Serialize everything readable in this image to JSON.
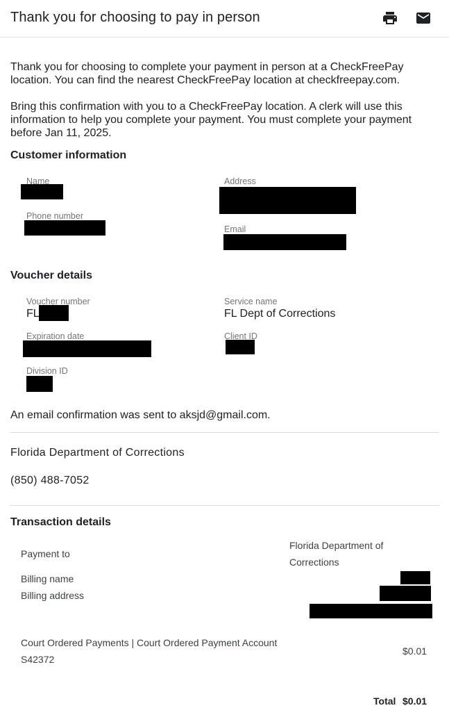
{
  "header": {
    "title": "Thank you for choosing to pay in person",
    "print_icon": "print-icon",
    "email_icon": "email-icon"
  },
  "intro": {
    "paragraph1": "Thank you for choosing to complete your payment in person at a CheckFreePay location. You can find the nearest CheckFreePay location at checkfreepay.com.",
    "paragraph2": "Bring this confirmation with you to a CheckFreePay location. A clerk will use this information to help you complete your payment. You must complete your payment before Jan 11, 2025."
  },
  "customer": {
    "heading": "Customer information",
    "name_label": "Name",
    "address_label": "Address",
    "phone_label": "Phone number",
    "email_label": "Email"
  },
  "voucher": {
    "heading": "Voucher details",
    "voucher_number_label": "Voucher number",
    "voucher_number_prefix": "FL",
    "service_name_label": "Service name",
    "service_name": "FL Dept of Corrections",
    "expiration_label": "Expiration date",
    "client_id_label": "Client ID",
    "division_id_label": "Division ID"
  },
  "email_confirmation": "An email confirmation was sent to aksjd@gmail.com.",
  "agency": {
    "name": "Florida Department of Corrections",
    "phone": "(850) 488-7052"
  },
  "transaction": {
    "heading": "Transaction details",
    "payment_to_label": "Payment to",
    "payment_to_value_line1": "Florida Department of",
    "payment_to_value_line2": "Corrections",
    "billing_name_label": "Billing name",
    "billing_address_label": "Billing address",
    "item_line1": "Court Ordered Payments | Court Ordered Payment Account",
    "item_line2": "S42372",
    "item_amount": "$0.01",
    "total_label": "Total",
    "total_value": "$0.01"
  }
}
